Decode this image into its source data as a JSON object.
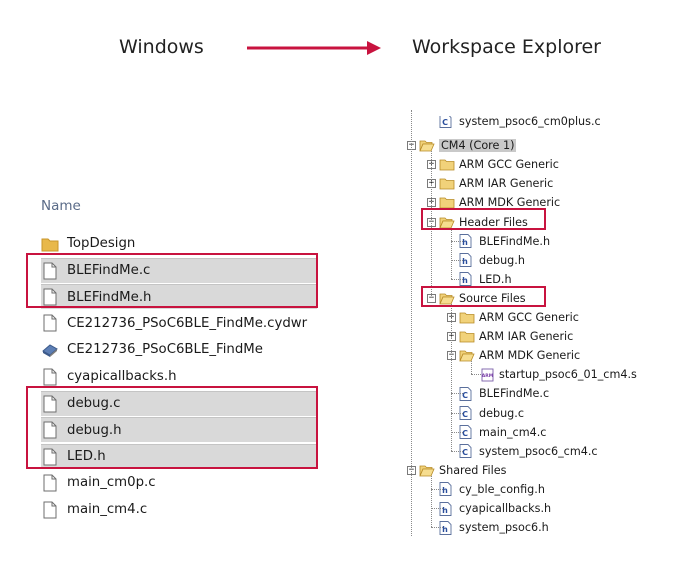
{
  "headings": {
    "left": "Windows",
    "right": "Workspace Explorer"
  },
  "colors": {
    "highlight": "#c8133f",
    "selected_row": "#d9d9d9",
    "name_header": "#5a6b88"
  },
  "windows": {
    "column_header": "Name",
    "files": [
      {
        "name": "TopDesign",
        "icon": "folder-icon",
        "selected": false
      },
      {
        "name": "BLEFindMe.c",
        "icon": "file-icon",
        "selected": true
      },
      {
        "name": "BLEFindMe.h",
        "icon": "file-icon",
        "selected": true
      },
      {
        "name": "CE212736_PSoC6BLE_FindMe.cydwr",
        "icon": "file-icon",
        "selected": false
      },
      {
        "name": "CE212736_PSoC6BLE_FindMe",
        "icon": "project-icon",
        "selected": false
      },
      {
        "name": "cyapicallbacks.h",
        "icon": "file-icon",
        "selected": false
      },
      {
        "name": "debug.c",
        "icon": "file-icon",
        "selected": true
      },
      {
        "name": "debug.h",
        "icon": "file-icon",
        "selected": true
      },
      {
        "name": "LED.h",
        "icon": "file-icon",
        "selected": true
      },
      {
        "name": "main_cm0p.c",
        "icon": "file-icon",
        "selected": false
      },
      {
        "name": "main_cm4.c",
        "icon": "file-icon",
        "selected": false
      }
    ]
  },
  "workspace": {
    "items": [
      {
        "label": "system_psoc6_cm0plus.c",
        "icon": "c-file-icon",
        "toggle": ""
      },
      {
        "label": "CM4 (Core 1)",
        "icon": "folder-open-icon",
        "toggle": "−",
        "highlight": true
      },
      {
        "label": "ARM GCC Generic",
        "icon": "folder-icon",
        "toggle": "+"
      },
      {
        "label": "ARM IAR Generic",
        "icon": "folder-icon",
        "toggle": "+"
      },
      {
        "label": "ARM MDK Generic",
        "icon": "folder-icon",
        "toggle": "+"
      },
      {
        "label": "Header Files",
        "icon": "folder-open-icon",
        "toggle": "−"
      },
      {
        "label": "BLEFindMe.h",
        "icon": "h-file-icon",
        "toggle": ""
      },
      {
        "label": "debug.h",
        "icon": "h-file-icon",
        "toggle": ""
      },
      {
        "label": "LED.h",
        "icon": "h-file-icon",
        "toggle": ""
      },
      {
        "label": "Source Files",
        "icon": "folder-open-icon",
        "toggle": "−"
      },
      {
        "label": "ARM GCC Generic",
        "icon": "folder-icon",
        "toggle": "+"
      },
      {
        "label": "ARM IAR Generic",
        "icon": "folder-icon",
        "toggle": "+"
      },
      {
        "label": "ARM MDK Generic",
        "icon": "folder-open-icon",
        "toggle": "−"
      },
      {
        "label": "startup_psoc6_01_cm4.s",
        "icon": "asm-file-icon",
        "toggle": ""
      },
      {
        "label": "BLEFindMe.c",
        "icon": "c-file-icon",
        "toggle": ""
      },
      {
        "label": "debug.c",
        "icon": "c-file-icon",
        "toggle": ""
      },
      {
        "label": "main_cm4.c",
        "icon": "c-file-icon",
        "toggle": ""
      },
      {
        "label": "system_psoc6_cm4.c",
        "icon": "c-file-icon",
        "toggle": ""
      },
      {
        "label": "Shared Files",
        "icon": "folder-open-icon",
        "toggle": "−"
      },
      {
        "label": "cy_ble_config.h",
        "icon": "h-file-icon",
        "toggle": ""
      },
      {
        "label": "cyapicallbacks.h",
        "icon": "h-file-icon",
        "toggle": ""
      },
      {
        "label": "system_psoc6.h",
        "icon": "h-file-icon",
        "toggle": ""
      }
    ]
  }
}
